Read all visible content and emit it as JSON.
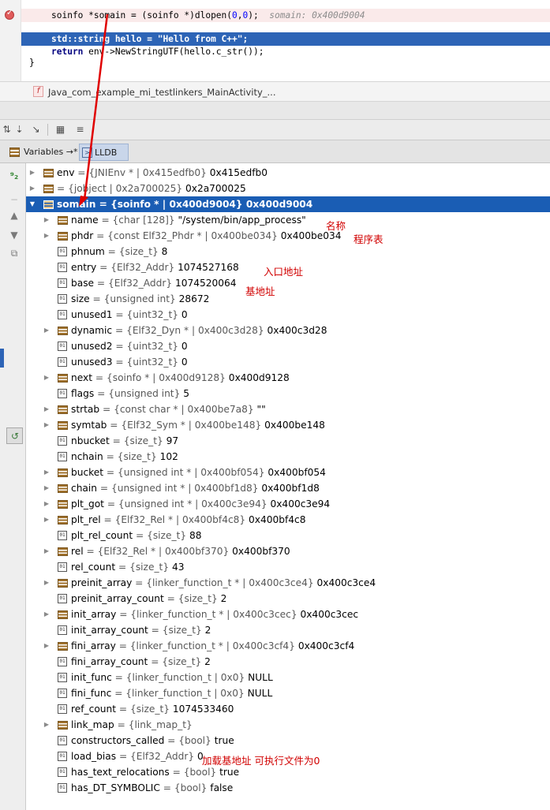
{
  "editor": {
    "line1": {
      "t1": "soinfo *somain = (soinfo *)dlopen(",
      "n1": "0",
      "t2": ",",
      "n2": "0",
      "t3": ");",
      "inline": "somain: 0x400d9004"
    },
    "line2": "std::string hello = \"Hello from C++\";",
    "line3": {
      "kw": "return",
      "rest": " env->NewStringUTF(hello.c_str());"
    },
    "line4": "}"
  },
  "breadcrumb": {
    "icon": "f",
    "text": "Java_com_example_mi_testlinkers_MainActivity_..."
  },
  "tabs": [
    {
      "label": "Variables →*"
    },
    {
      "label": "LLDB →*"
    }
  ],
  "variables": [
    {
      "depth": 0,
      "expand": true,
      "icon": "obj",
      "name": "env",
      "type": " = {JNIEnv * | 0x415edfb0}",
      "value": " 0x415edfb0"
    },
    {
      "depth": 0,
      "expand": true,
      "icon": "obj",
      "name": "",
      "type": " = {jobject | 0x2a700025}",
      "value": " 0x2a700025"
    },
    {
      "depth": 0,
      "expanded": true,
      "selected": true,
      "icon": "obj",
      "name": "somain",
      "type": " = {soinfo * | 0x400d9004}",
      "value": " 0x400d9004"
    },
    {
      "depth": 1,
      "expand": true,
      "icon": "obj",
      "name": "name",
      "type": " = {char [128]}",
      "value": " \"/system/bin/app_process\""
    },
    {
      "depth": 1,
      "expand": true,
      "icon": "obj",
      "name": "phdr",
      "type": " = {const Elf32_Phdr * | 0x400be034}",
      "value": " 0x400be034"
    },
    {
      "depth": 1,
      "icon": "prim",
      "name": "phnum",
      "type": " = {size_t}",
      "value": " 8"
    },
    {
      "depth": 1,
      "icon": "prim",
      "name": "entry",
      "type": " = {Elf32_Addr}",
      "value": " 1074527168"
    },
    {
      "depth": 1,
      "icon": "prim",
      "name": "base",
      "type": " = {Elf32_Addr}",
      "value": " 1074520064"
    },
    {
      "depth": 1,
      "icon": "prim",
      "name": "size",
      "type": " = {unsigned int}",
      "value": " 28672"
    },
    {
      "depth": 1,
      "icon": "prim",
      "name": "unused1",
      "type": " = {uint32_t}",
      "value": " 0"
    },
    {
      "depth": 1,
      "expand": true,
      "icon": "obj",
      "name": "dynamic",
      "type": " = {Elf32_Dyn * | 0x400c3d28}",
      "value": " 0x400c3d28"
    },
    {
      "depth": 1,
      "icon": "prim",
      "name": "unused2",
      "type": " = {uint32_t}",
      "value": " 0"
    },
    {
      "depth": 1,
      "icon": "prim",
      "name": "unused3",
      "type": " = {uint32_t}",
      "value": " 0"
    },
    {
      "depth": 1,
      "expand": true,
      "icon": "obj",
      "name": "next",
      "type": " = {soinfo * | 0x400d9128}",
      "value": " 0x400d9128"
    },
    {
      "depth": 1,
      "icon": "prim",
      "name": "flags",
      "type": " = {unsigned int}",
      "value": " 5"
    },
    {
      "depth": 1,
      "expand": true,
      "icon": "obj",
      "name": "strtab",
      "type": " = {const char * | 0x400be7a8}",
      "value": " \"\""
    },
    {
      "depth": 1,
      "expand": true,
      "icon": "obj",
      "name": "symtab",
      "type": " = {Elf32_Sym * | 0x400be148}",
      "value": " 0x400be148"
    },
    {
      "depth": 1,
      "icon": "prim",
      "name": "nbucket",
      "type": " = {size_t}",
      "value": " 97"
    },
    {
      "depth": 1,
      "icon": "prim",
      "name": "nchain",
      "type": " = {size_t}",
      "value": " 102"
    },
    {
      "depth": 1,
      "expand": true,
      "icon": "obj",
      "name": "bucket",
      "type": " = {unsigned int * | 0x400bf054}",
      "value": " 0x400bf054"
    },
    {
      "depth": 1,
      "expand": true,
      "icon": "obj",
      "name": "chain",
      "type": " = {unsigned int * | 0x400bf1d8}",
      "value": " 0x400bf1d8"
    },
    {
      "depth": 1,
      "expand": true,
      "icon": "obj",
      "name": "plt_got",
      "type": " = {unsigned int * | 0x400c3e94}",
      "value": " 0x400c3e94"
    },
    {
      "depth": 1,
      "expand": true,
      "icon": "obj",
      "name": "plt_rel",
      "type": " = {Elf32_Rel * | 0x400bf4c8}",
      "value": " 0x400bf4c8"
    },
    {
      "depth": 1,
      "icon": "prim",
      "name": "plt_rel_count",
      "type": " = {size_t}",
      "value": " 88"
    },
    {
      "depth": 1,
      "expand": true,
      "icon": "obj",
      "name": "rel",
      "type": " = {Elf32_Rel * | 0x400bf370}",
      "value": " 0x400bf370"
    },
    {
      "depth": 1,
      "icon": "prim",
      "name": "rel_count",
      "type": " = {size_t}",
      "value": " 43"
    },
    {
      "depth": 1,
      "expand": true,
      "icon": "obj",
      "name": "preinit_array",
      "type": " = {linker_function_t * | 0x400c3ce4}",
      "value": " 0x400c3ce4"
    },
    {
      "depth": 1,
      "icon": "prim",
      "name": "preinit_array_count",
      "type": " = {size_t}",
      "value": " 2"
    },
    {
      "depth": 1,
      "expand": true,
      "icon": "obj",
      "name": "init_array",
      "type": " = {linker_function_t * | 0x400c3cec}",
      "value": " 0x400c3cec"
    },
    {
      "depth": 1,
      "icon": "prim",
      "name": "init_array_count",
      "type": " = {size_t}",
      "value": " 2"
    },
    {
      "depth": 1,
      "expand": true,
      "icon": "obj",
      "name": "fini_array",
      "type": " = {linker_function_t * | 0x400c3cf4}",
      "value": " 0x400c3cf4"
    },
    {
      "depth": 1,
      "icon": "prim",
      "name": "fini_array_count",
      "type": " = {size_t}",
      "value": " 2"
    },
    {
      "depth": 1,
      "icon": "prim",
      "name": "init_func",
      "type": " = {linker_function_t | 0x0}",
      "value": " NULL"
    },
    {
      "depth": 1,
      "icon": "prim",
      "name": "fini_func",
      "type": " = {linker_function_t | 0x0}",
      "value": " NULL"
    },
    {
      "depth": 1,
      "icon": "prim",
      "name": "ref_count",
      "type": " = {size_t}",
      "value": " 1074533460"
    },
    {
      "depth": 1,
      "expand": true,
      "icon": "obj",
      "name": "link_map",
      "type": " = {link_map_t}",
      "value": ""
    },
    {
      "depth": 1,
      "icon": "prim",
      "name": "constructors_called",
      "type": " = {bool}",
      "value": " true"
    },
    {
      "depth": 1,
      "icon": "prim",
      "name": "load_bias",
      "type": " = {Elf32_Addr}",
      "value": " 0"
    },
    {
      "depth": 1,
      "icon": "prim",
      "name": "has_text_relocations",
      "type": " = {bool}",
      "value": " true"
    },
    {
      "depth": 1,
      "icon": "prim",
      "name": "has_DT_SYMBOLIC",
      "type": " = {bool}",
      "value": " false"
    }
  ],
  "annotations": {
    "name": "名称",
    "phdr": "程序表",
    "entry": "入口地址",
    "base": "基地址",
    "load_bias": "加载基地址 可执行文件为0"
  },
  "colors": {
    "selection": "#1a5db4",
    "annotation": "#d10000",
    "breakpoint": "#e05c5c"
  }
}
